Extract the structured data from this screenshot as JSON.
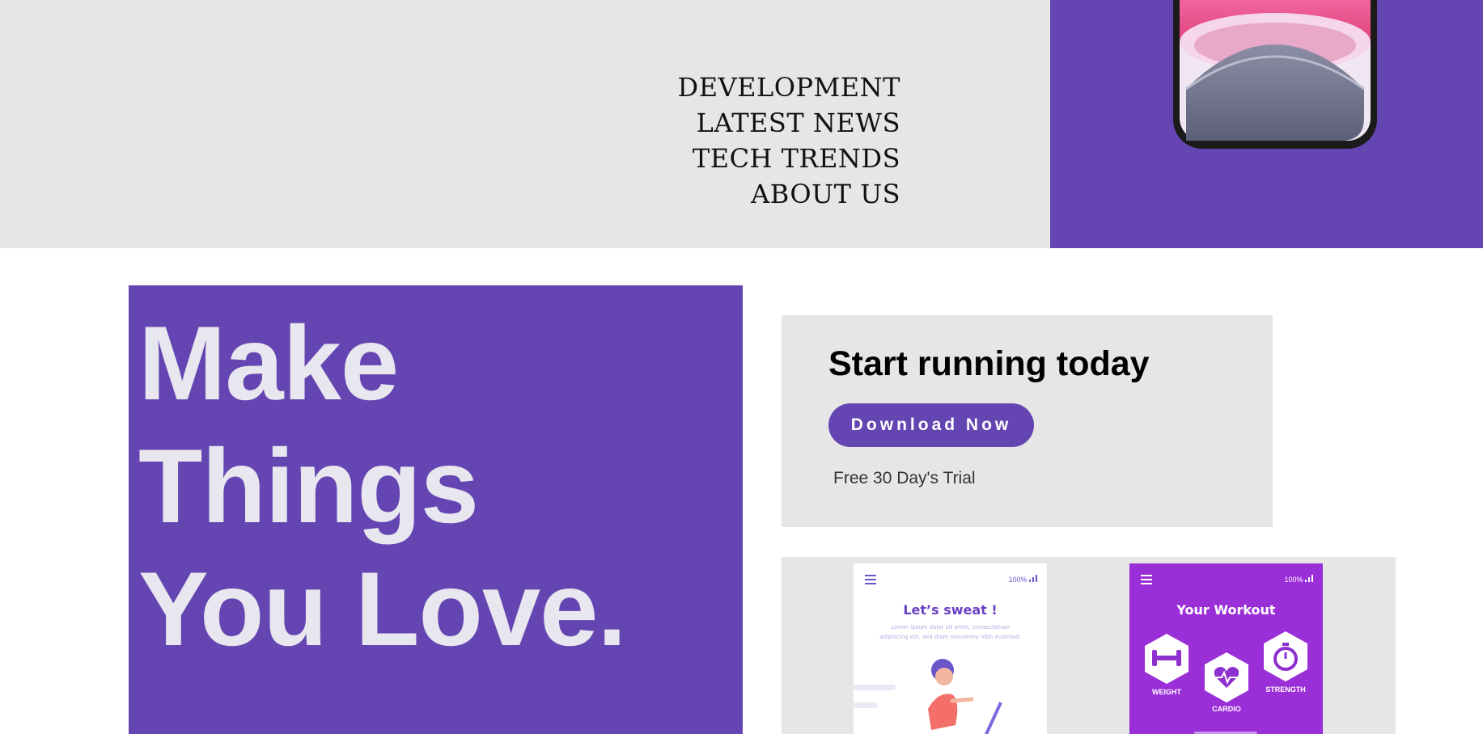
{
  "nav": {
    "items": [
      "DEVELOPMENT",
      "LATEST NEWS",
      "TECH TRENDS",
      "ABOUT US"
    ]
  },
  "hero": {
    "lines": [
      "Make",
      "Things",
      "You Love."
    ]
  },
  "cta": {
    "title": "Start running today",
    "button": "Download Now",
    "note": "Free 30 Day's Trial"
  },
  "app1": {
    "battery": "100%",
    "title": "Let’s sweat !",
    "body_line1": "Lorem ipsum dolor sit amet, consectetuer",
    "body_line2": "adipiscing elit, sed diam nonummy nibh euismod."
  },
  "app2": {
    "battery": "100%",
    "title": "Your Workout",
    "items": [
      "WEIGHT",
      "CARDIO",
      "STRENGTH"
    ]
  },
  "colors": {
    "accent": "#6445b2",
    "panel": "#e6e6e6",
    "workout": "#9a2fd8"
  },
  "icons": [
    "menu-icon",
    "signal-icon",
    "dumbbell-icon",
    "heart-pulse-icon",
    "stopwatch-icon"
  ]
}
